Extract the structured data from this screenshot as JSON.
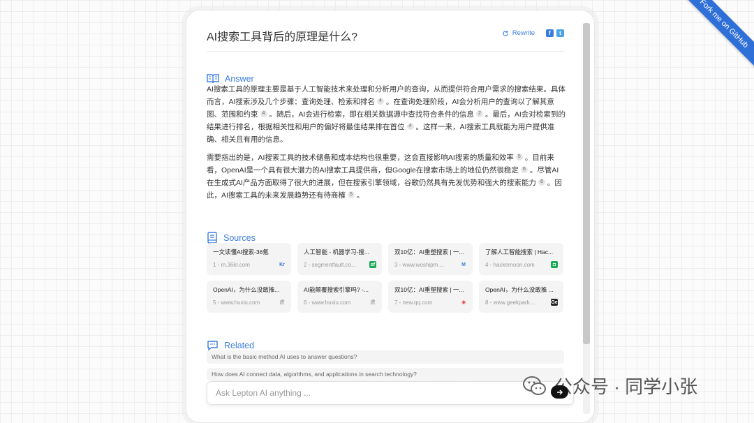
{
  "ribbon": {
    "label": "Fork me on GitHub"
  },
  "header": {
    "query": "AI搜索工具背后的原理是什么?",
    "rewrite_label": "Rewrite",
    "facebook_glyph": "f",
    "twitter_glyph": "t"
  },
  "answer": {
    "heading": "Answer",
    "p1": [
      {
        "text": "AI搜索工具的原理主要是基于人工智能技术来处理和分析用户的查询，从而提供符合用户需求的搜索结果。具体而言，AI搜索涉及几个步骤：查询处理、检索和排名",
        "cite": "4"
      },
      {
        "text": "。在查询处理阶段，AI会分析用户的查询以了解其意图、范围和约束",
        "cite": "4"
      },
      {
        "text": "。随后，AI会进行检索，即在相关数据源中查找符合条件的信息",
        "cite": "2"
      },
      {
        "text": "。最后，AI会对检索到的结果进行排名，根据相关性和用户的偏好将最佳结果排在首位",
        "cite": "4"
      },
      {
        "text": "。这样一来，AI搜索工具就能为用户提供准确、相关且有用的信息。",
        "cite": ""
      }
    ],
    "p2": [
      {
        "text": "需要指出的是，AI搜索工具的技术储备和成本结构也很重要，这会直接影响AI搜索的质量和效率",
        "cite": "5"
      },
      {
        "text": "。目前来看，OpenAI是一个具有很大潜力的AI搜索工具提供商，但Google在搜索市场上的地位仍然很稳定",
        "cite": "6"
      },
      {
        "text": "。尽管AI在生成式AI产品方面取得了很大的进展，但在搜索引擎领域，谷歌仍然具有先发优势和强大的搜索能力",
        "cite": "6"
      },
      {
        "text": "。因此，AI搜索工具的未来发展趋势还有待商榷",
        "cite": "5"
      },
      {
        "text": "。",
        "cite": ""
      }
    ]
  },
  "sources": {
    "heading": "Sources",
    "items": [
      {
        "title": "一文读懂AI搜索-36氪",
        "domain": "1 - m.36kr.com",
        "favicon": "Kr",
        "favicon_color": "#2f6fd8",
        "favicon_bg": "transparent"
      },
      {
        "title": "人工智能 - 机器学习-搜...",
        "domain": "2 - segmentfault.co...",
        "favicon": "sf",
        "favicon_color": "#ffffff",
        "favicon_bg": "#1aaa55"
      },
      {
        "title": "双10亿：AI重塑搜索 | 一...",
        "domain": "3 - www.woshipm....",
        "favicon": "M",
        "favicon_color": "#3b7ddd",
        "favicon_bg": "transparent"
      },
      {
        "title": "了解人工智能搜索 | Hac...",
        "domain": "4 - hackernoon.com",
        "favicon": "◘",
        "favicon_color": "#ffffff",
        "favicon_bg": "#1aaa55"
      },
      {
        "title": "OpenAI，为什么没敢推...",
        "domain": "5 - www.huxiu.com",
        "favicon": "虎",
        "favicon_color": "#aaaaaa",
        "favicon_bg": "transparent"
      },
      {
        "title": "AI能颠覆搜索引擎吗? -...",
        "domain": "6 - www.huxiu.com",
        "favicon": "虎",
        "favicon_color": "#aaaaaa",
        "favicon_bg": "transparent"
      },
      {
        "title": "双10亿：AI重塑搜索 | 一...",
        "domain": "7 - new.qq.com",
        "favicon": "◉",
        "favicon_color": "#e23b3b",
        "favicon_bg": "transparent"
      },
      {
        "title": "OpenAI，为什么没敢推 ...",
        "domain": "8 - www.geekpark....",
        "favicon": "Ge",
        "favicon_color": "#ffffff",
        "favicon_bg": "#222222"
      }
    ]
  },
  "related": {
    "heading": "Related",
    "items": [
      "What is the basic method AI uses to answer questions?",
      "How does AI connect data, algorithms, and applications in search technology?"
    ]
  },
  "input": {
    "placeholder": "Ask Lepton AI anything ..."
  },
  "watermark": {
    "text": "公众号 · 同学小张"
  },
  "colors": {
    "accent": "#3b7ddd",
    "card_bg": "#f4f4f4",
    "send_button": "#111111"
  }
}
